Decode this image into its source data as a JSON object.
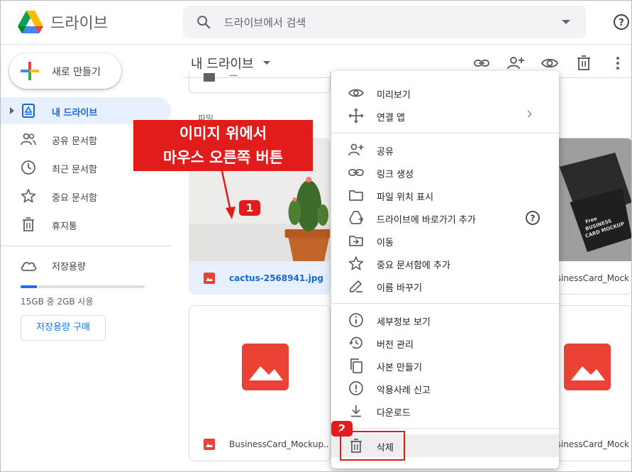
{
  "app": {
    "title": "드라이브"
  },
  "search": {
    "placeholder": "드라이브에서 검색"
  },
  "sidebar": {
    "new_button": "새로 만들기",
    "items": [
      {
        "label": "내 드라이브",
        "icon": "my-drive-icon",
        "active": true
      },
      {
        "label": "공유 문서함",
        "icon": "shared-icon"
      },
      {
        "label": "최근 문서함",
        "icon": "clock-icon"
      },
      {
        "label": "중요 문서함",
        "icon": "star-icon"
      },
      {
        "label": "휴지통",
        "icon": "trash-icon"
      }
    ],
    "storage": {
      "label": "저장용량",
      "usage_text": "15GB 중 2GB 사용",
      "used_fraction": 0.13,
      "buy_button": "저장용량 구매"
    }
  },
  "main": {
    "title": "내 드라이브",
    "section_label": "파일",
    "folder_peek": "—",
    "files": [
      {
        "name": "cactus-2568941.jpg",
        "selected": true
      },
      {
        "name": "BusinessCard_Mockup...",
        "selected": false
      },
      {
        "name": "usinessCard_Mock",
        "selected": false
      },
      {
        "name": "usinessCard_Mock",
        "selected": false
      }
    ]
  },
  "context_menu": {
    "groups": [
      [
        "미리보기",
        "연결 앱"
      ],
      [
        "공유",
        "링크 생성",
        "파일 위치 표시",
        "드라이브에 바로가기 추가",
        "이동",
        "중요 문서함에 추가",
        "이름 바꾸기"
      ],
      [
        "세부정보 보기",
        "버전 관리",
        "사본 만들기",
        "악용사례 신고",
        "다운로드"
      ],
      [
        "삭제"
      ]
    ]
  },
  "annotation": {
    "callout_line1": "이미지 위에서",
    "callout_line2": "마우스 오른쪽 버튼",
    "badge1": "1",
    "badge2": "2"
  },
  "colors": {
    "accent": "#1a73e8",
    "annotation_red": "#e21b1b",
    "selected_bg": "#e8f0fe",
    "file_red": "#ea4335"
  }
}
